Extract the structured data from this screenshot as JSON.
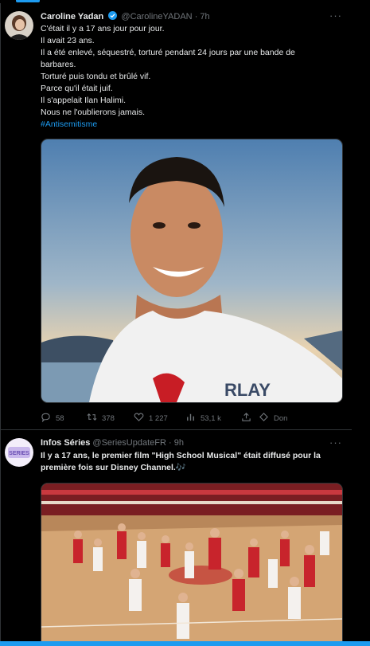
{
  "tweets": [
    {
      "author_name": "Caroline Yadan",
      "handle": "@CarolineYADAN",
      "separator": "·",
      "time": "7h",
      "more": "···",
      "lines": [
        "C'était il y a 17 ans jour pour jour.",
        "Il avait 23 ans.",
        "Il a été enlevé, séquestré, torturé pendant 24 jours par une bande de",
        "barbares.",
        "Torturé puis tondu et brûlé vif.",
        "Parce qu'il était juif.",
        "Il s'appelait Ilan Halimi.",
        "Nous ne l'oublierons jamais."
      ],
      "hashtag": "#Antisemitisme",
      "replies": "58",
      "retweets": "378",
      "likes": "1 227",
      "views": "53,1 k",
      "share": "",
      "donate": "Don"
    },
    {
      "author_name": "Infos Séries",
      "handle": "@SeriesUpdateFR",
      "separator": "·",
      "time": "9h",
      "more": "···",
      "avatar_text": "SERIES",
      "lines": [
        "Il y a 17 ans, le premier film \"High School Musical\" était diffusé pour la",
        "première fois sur Disney Channel.🎶"
      ]
    }
  ],
  "colors": {
    "accent": "#1d9bf0",
    "text": "#e7e9ea",
    "muted": "#71767b",
    "border": "#2f3336",
    "background": "#000000"
  }
}
